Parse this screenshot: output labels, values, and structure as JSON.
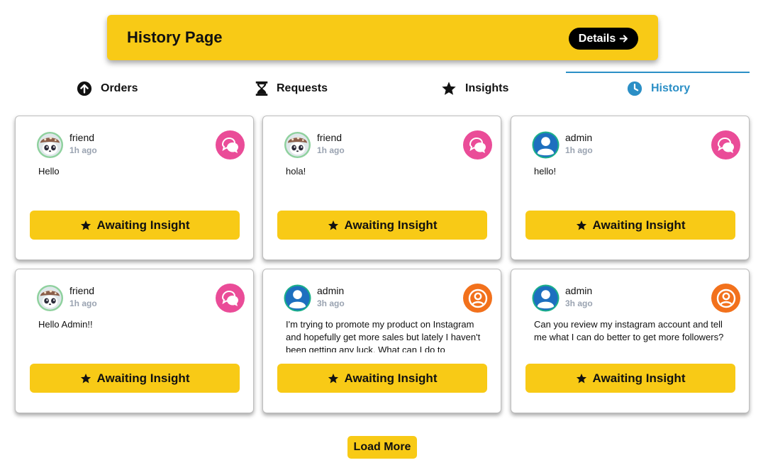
{
  "header": {
    "title": "History Page",
    "details_label": "Details",
    "arrow_icon": "arrow-right-icon",
    "background_color": "#f8ca16"
  },
  "tabs": [
    {
      "label": "Orders",
      "icon": "arrow-up-circle-icon",
      "active": false
    },
    {
      "label": "Requests",
      "icon": "hourglass-icon",
      "active": false
    },
    {
      "label": "Insights",
      "icon": "star-icon",
      "active": false
    },
    {
      "label": "History",
      "icon": "clock-icon",
      "active": true
    }
  ],
  "active_tab_color": "#2b8fc6",
  "cards": [
    {
      "username": "friend",
      "time": "1h ago",
      "avatar": "panda-mushroom-avatar",
      "type_icon": "chat-bubbles-icon",
      "type_color": "#ea4c98",
      "message": "Hello",
      "button_label": "Awaiting Insight"
    },
    {
      "username": "friend",
      "time": "1h ago",
      "avatar": "panda-mushroom-avatar",
      "type_icon": "chat-bubbles-icon",
      "type_color": "#ea4c98",
      "message": "hola!",
      "button_label": "Awaiting Insight"
    },
    {
      "username": "admin",
      "time": "1h ago",
      "avatar": "default-user-avatar",
      "type_icon": "chat-bubbles-icon",
      "type_color": "#ea4c98",
      "message": "hello!",
      "button_label": "Awaiting Insight"
    },
    {
      "username": "friend",
      "time": "1h ago",
      "avatar": "panda-mushroom-avatar",
      "type_icon": "chat-bubbles-icon",
      "type_color": "#ea4c98",
      "message": "Hello Admin!!",
      "button_label": "Awaiting Insight"
    },
    {
      "username": "admin",
      "time": "3h ago",
      "avatar": "default-user-avatar",
      "type_icon": "user-circle-icon",
      "type_color": "#f2711c",
      "message": "I'm trying to promote my product on Instagram and hopefully get more sales but lately I haven't been getting any luck. What can I do to",
      "button_label": "Awaiting Insight"
    },
    {
      "username": "admin",
      "time": "3h ago",
      "avatar": "default-user-avatar",
      "type_icon": "user-circle-icon",
      "type_color": "#f2711c",
      "message": "Can you review my instagram account and tell me what I can do better to get more followers?",
      "button_label": "Awaiting Insight"
    }
  ],
  "load_more_label": "Load More"
}
